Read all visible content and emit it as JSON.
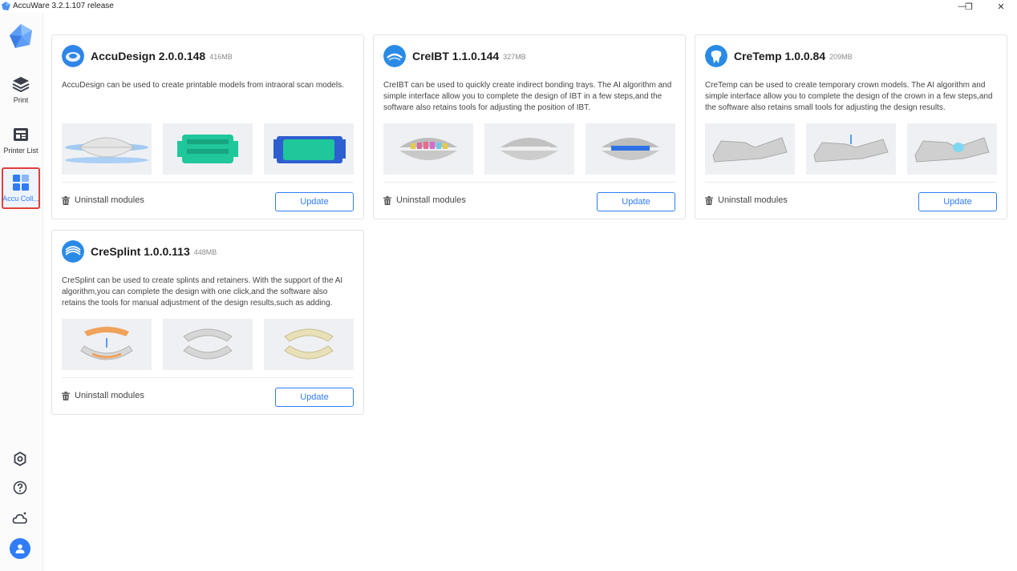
{
  "window": {
    "title": "AccuWare 3.2.1.107 release",
    "controls": {
      "minimize": "—",
      "maximize": "❐",
      "close": "✕"
    }
  },
  "sidebar": {
    "items": [
      {
        "label": "Print",
        "icon": "layers-icon"
      },
      {
        "label": "Printer List",
        "icon": "printer-list-icon"
      },
      {
        "label": "Accu Coll...",
        "icon": "apps-grid-icon",
        "active": true
      }
    ],
    "bottom_icons": [
      "settings-icon",
      "help-icon",
      "cloud-icon",
      "user-avatar-icon"
    ]
  },
  "colors": {
    "accent": "#2f7cf6",
    "active_border": "#e0403a",
    "card_border": "#e3e3e3"
  },
  "modules": [
    {
      "name": "AccuDesign 2.0.0.148",
      "size": "416MB",
      "description": "AccuDesign can be used to create printable models from intraoral scan models.",
      "uninstall_label": "Uninstall modules",
      "update_label": "Update"
    },
    {
      "name": "CreIBT 1.1.0.144",
      "size": "327MB",
      "description": "CreIBT can be used to quickly create indirect bonding trays. The AI algorithm and simple interface allow you to complete the design of IBT in a few steps,and the software also retains tools for adjusting the position of IBT.",
      "uninstall_label": "Uninstall modules",
      "update_label": "Update"
    },
    {
      "name": "CreTemp 1.0.0.84",
      "size": "209MB",
      "description": "CreTemp can be used to create temporary crown models. The AI algorithm and simple interface allow you to complete the design of the crown in a few steps,and the software also retains small tools for adjusting the design results.",
      "uninstall_label": "Uninstall modules",
      "update_label": "Update"
    },
    {
      "name": "CreSplint 1.0.0.113",
      "size": "448MB",
      "description": "CreSplint can be used to create splints and retainers. With the support of the AI algorithm,you can complete the design with one click,and the software also retains the tools for manual adjustment of the design results,such as adding.",
      "uninstall_label": "Uninstall modules",
      "update_label": "Update"
    }
  ]
}
